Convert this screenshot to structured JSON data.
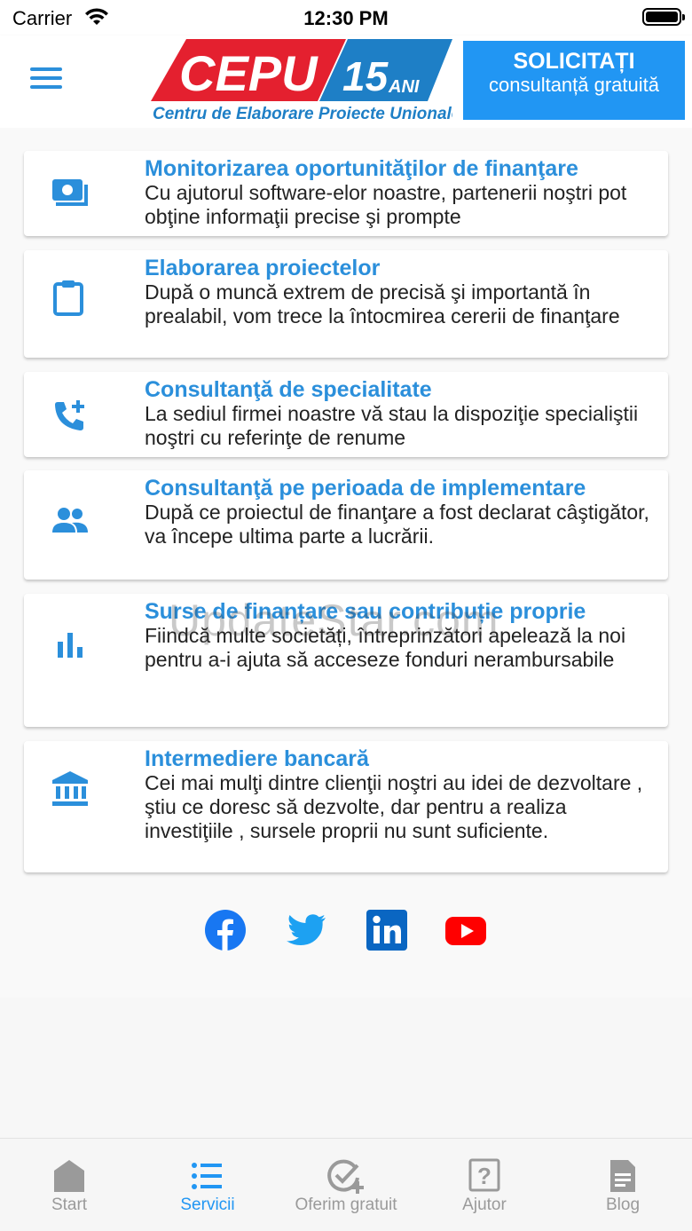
{
  "status_bar": {
    "carrier": "Carrier",
    "time": "12:30 PM"
  },
  "header": {
    "logo": {
      "brand": "CEPU",
      "years": "15",
      "years_suffix": "ANI",
      "tagline": "Centru de Elaborare Proiecte Unionale"
    },
    "cta": {
      "line1": "SOLICITAȚI",
      "line2": "consultanță gratuită"
    }
  },
  "colors": {
    "accent": "#2196f3",
    "title_blue": "#2b8fdb",
    "logo_red": "#e4202f",
    "logo_blue": "#1e7fc6"
  },
  "services": [
    {
      "icon": "money-icon",
      "title": "Monitorizarea oportunităţilor de finanţare",
      "description": "Cu ajutorul software-elor noastre, partenerii noştri pot obţine informaţii precise şi prompte"
    },
    {
      "icon": "clipboard-icon",
      "title": "Elaborarea proiectelor",
      "description": "După o muncă extrem de precisă şi importantă în prealabil, vom trece la întocmirea cererii de finanţare"
    },
    {
      "icon": "phone-add-icon",
      "title": "Consultanţă de specialitate",
      "description": "La sediul firmei noastre vă stau la dispoziţie specialiştii noştri cu referinţe de renume"
    },
    {
      "icon": "people-icon",
      "title": "Consultanţă pe perioada de implementare",
      "description": "După ce proiectul de finanţare a fost declarat câştigător, va începe ultima parte a lucrării."
    },
    {
      "icon": "bar-chart-icon",
      "title": "Surse de finanțare sau contribuție proprie",
      "description": "Fiindcă multe societăți, întreprinzători apelează la noi pentru a-i ajuta să acceseze fonduri nerambursabile"
    },
    {
      "icon": "bank-icon",
      "title": "Intermediere bancară",
      "description": "Cei mai mulţi dintre clienţii noştri au idei de dezvoltare , ştiu ce doresc să dezvolte, dar pentru a realiza investiţiile , sursele proprii nu sunt suficiente."
    }
  ],
  "social": [
    "facebook-icon",
    "twitter-icon",
    "linkedin-icon",
    "youtube-icon"
  ],
  "watermark": "UpdateStar.com",
  "tabs": [
    {
      "label": "Start",
      "icon": "home-icon",
      "active": false
    },
    {
      "label": "Servicii",
      "icon": "list-icon",
      "active": true
    },
    {
      "label": "Oferim gratuit",
      "icon": "check-add-icon",
      "active": false
    },
    {
      "label": "Ajutor",
      "icon": "question-icon",
      "active": false
    },
    {
      "label": "Blog",
      "icon": "document-icon",
      "active": false
    }
  ]
}
